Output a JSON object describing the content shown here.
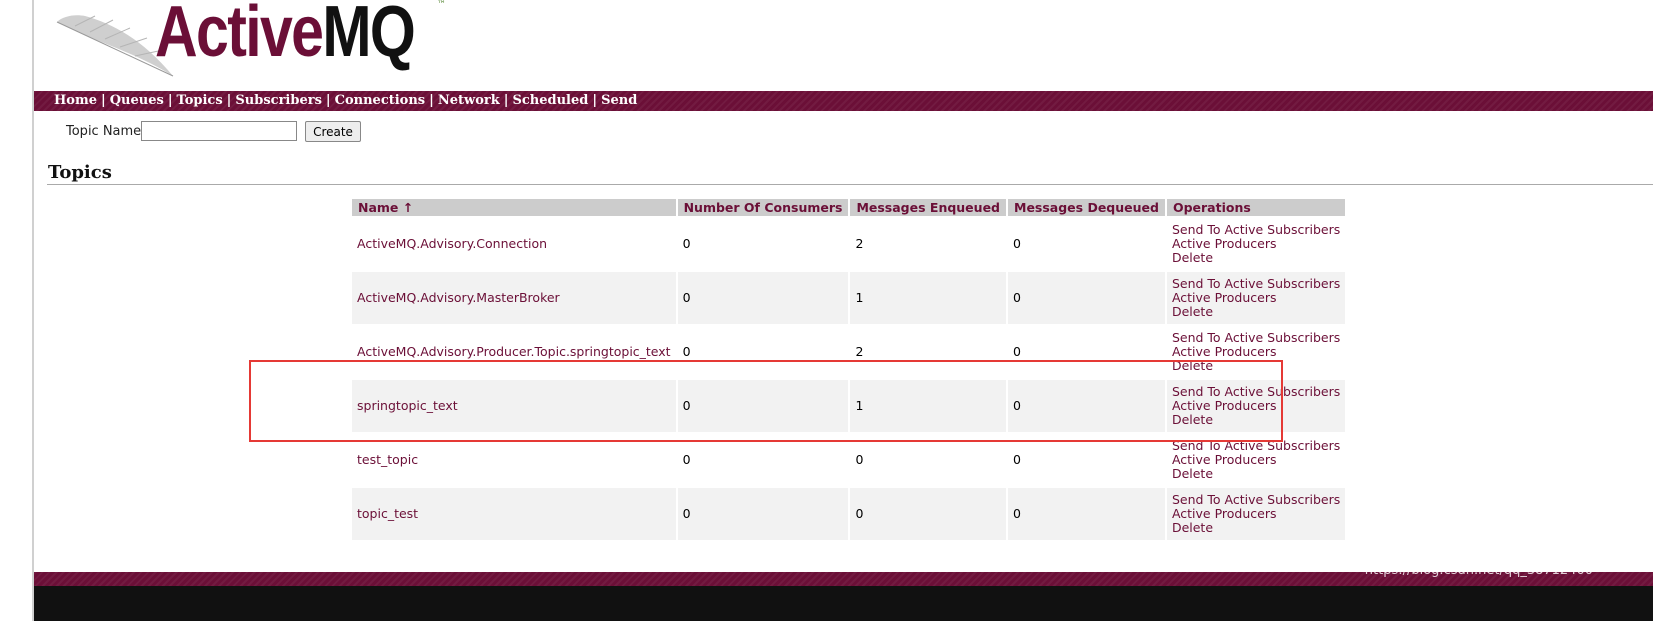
{
  "logo": {
    "text_part1": "Active",
    "text_part2": "MQ",
    "tm": "™"
  },
  "nav": {
    "items": [
      "Home",
      "Queues",
      "Topics",
      "Subscribers",
      "Connections",
      "Network",
      "Scheduled",
      "Send"
    ],
    "separator": "|"
  },
  "create_form": {
    "label": "Topic Name",
    "value": "",
    "button": "Create"
  },
  "page_title": "Topics",
  "table": {
    "headers": [
      "Name ↑",
      "Number Of Consumers",
      "Messages Enqueued",
      "Messages Dequeued",
      "Operations"
    ],
    "rows": [
      {
        "name": "ActiveMQ.Advisory.Connection",
        "consumers": "0",
        "enqueued": "2",
        "dequeued": "0"
      },
      {
        "name": "ActiveMQ.Advisory.MasterBroker",
        "consumers": "0",
        "enqueued": "1",
        "dequeued": "0"
      },
      {
        "name": "ActiveMQ.Advisory.Producer.Topic.springtopic_text",
        "consumers": "0",
        "enqueued": "2",
        "dequeued": "0"
      },
      {
        "name": "springtopic_text",
        "consumers": "0",
        "enqueued": "1",
        "dequeued": "0"
      },
      {
        "name": "test_topic",
        "consumers": "0",
        "enqueued": "0",
        "dequeued": "0"
      },
      {
        "name": "topic_test",
        "consumers": "0",
        "enqueued": "0",
        "dequeued": "0"
      }
    ],
    "operations": [
      "Send To Active Subscribers",
      "Active Producers",
      "Delete"
    ]
  },
  "watermark": "https://blog.csdn.net/qq_38712400",
  "colors": {
    "brand": "#6b0f37",
    "header_bg": "#cccccc",
    "highlight": "#e53935"
  }
}
